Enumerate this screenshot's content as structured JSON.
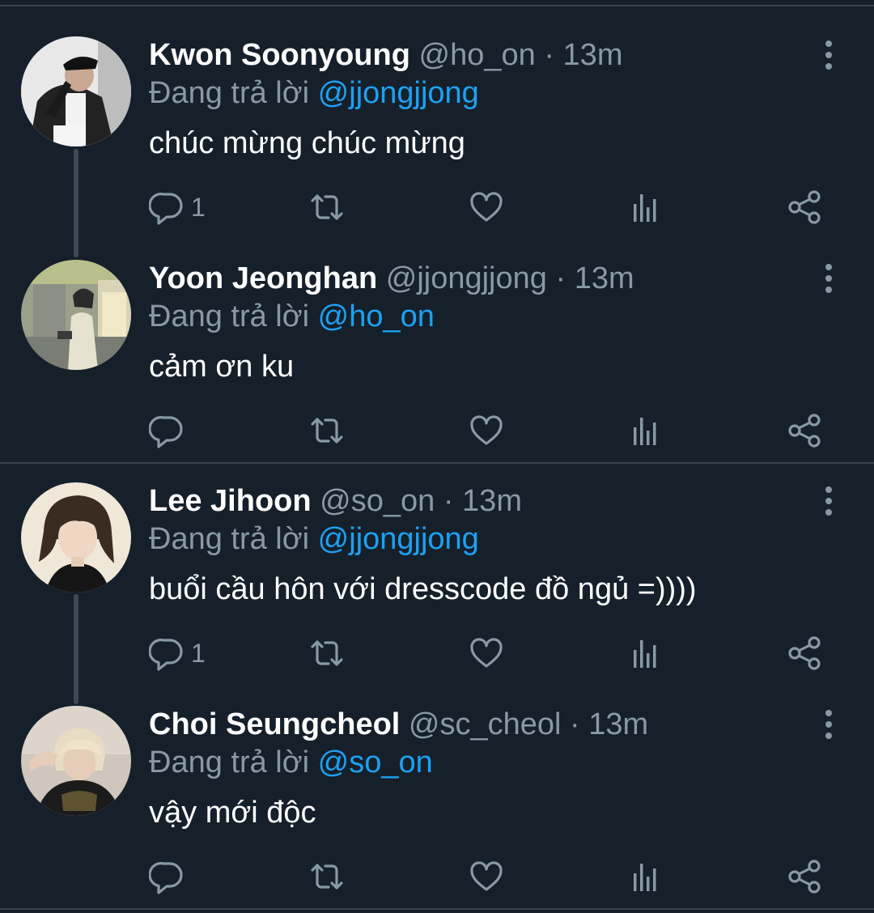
{
  "theme": {
    "background": "#15202b",
    "divider": "#38444d",
    "muted": "#8899a6",
    "link": "#1da1f2",
    "text": "#ffffff"
  },
  "reply_prefix": "Đang trả lời",
  "tweets": [
    {
      "display_name": "Kwon Soonyoung",
      "handle": "@ho_on",
      "separator": "·",
      "time": "13m",
      "reply_to": "@jjongjjong",
      "text": "chúc mừng chúc mừng",
      "reply_count": "1",
      "icons": [
        "reply-icon",
        "retweet-icon",
        "like-icon",
        "analytics-icon",
        "share-icon",
        "more-icon"
      ]
    },
    {
      "display_name": "Yoon Jeonghan",
      "handle": "@jjongjjong",
      "separator": "·",
      "time": "13m",
      "reply_to": "@ho_on",
      "text": "cảm ơn ku",
      "reply_count": "",
      "icons": [
        "reply-icon",
        "retweet-icon",
        "like-icon",
        "analytics-icon",
        "share-icon",
        "more-icon"
      ]
    },
    {
      "display_name": "Lee Jihoon",
      "handle": "@so_on",
      "separator": "·",
      "time": "13m",
      "reply_to": "@jjongjjong",
      "text": "buổi cầu hôn với dresscode đồ ngủ =))))",
      "reply_count": "1",
      "icons": [
        "reply-icon",
        "retweet-icon",
        "like-icon",
        "analytics-icon",
        "share-icon",
        "more-icon"
      ]
    },
    {
      "display_name": "Choi Seungcheol",
      "handle": "@sc_cheol",
      "separator": "·",
      "time": "13m",
      "reply_to": "@so_on",
      "text": "vậy mới độc",
      "reply_count": "",
      "icons": [
        "reply-icon",
        "retweet-icon",
        "like-icon",
        "analytics-icon",
        "share-icon",
        "more-icon"
      ]
    }
  ]
}
